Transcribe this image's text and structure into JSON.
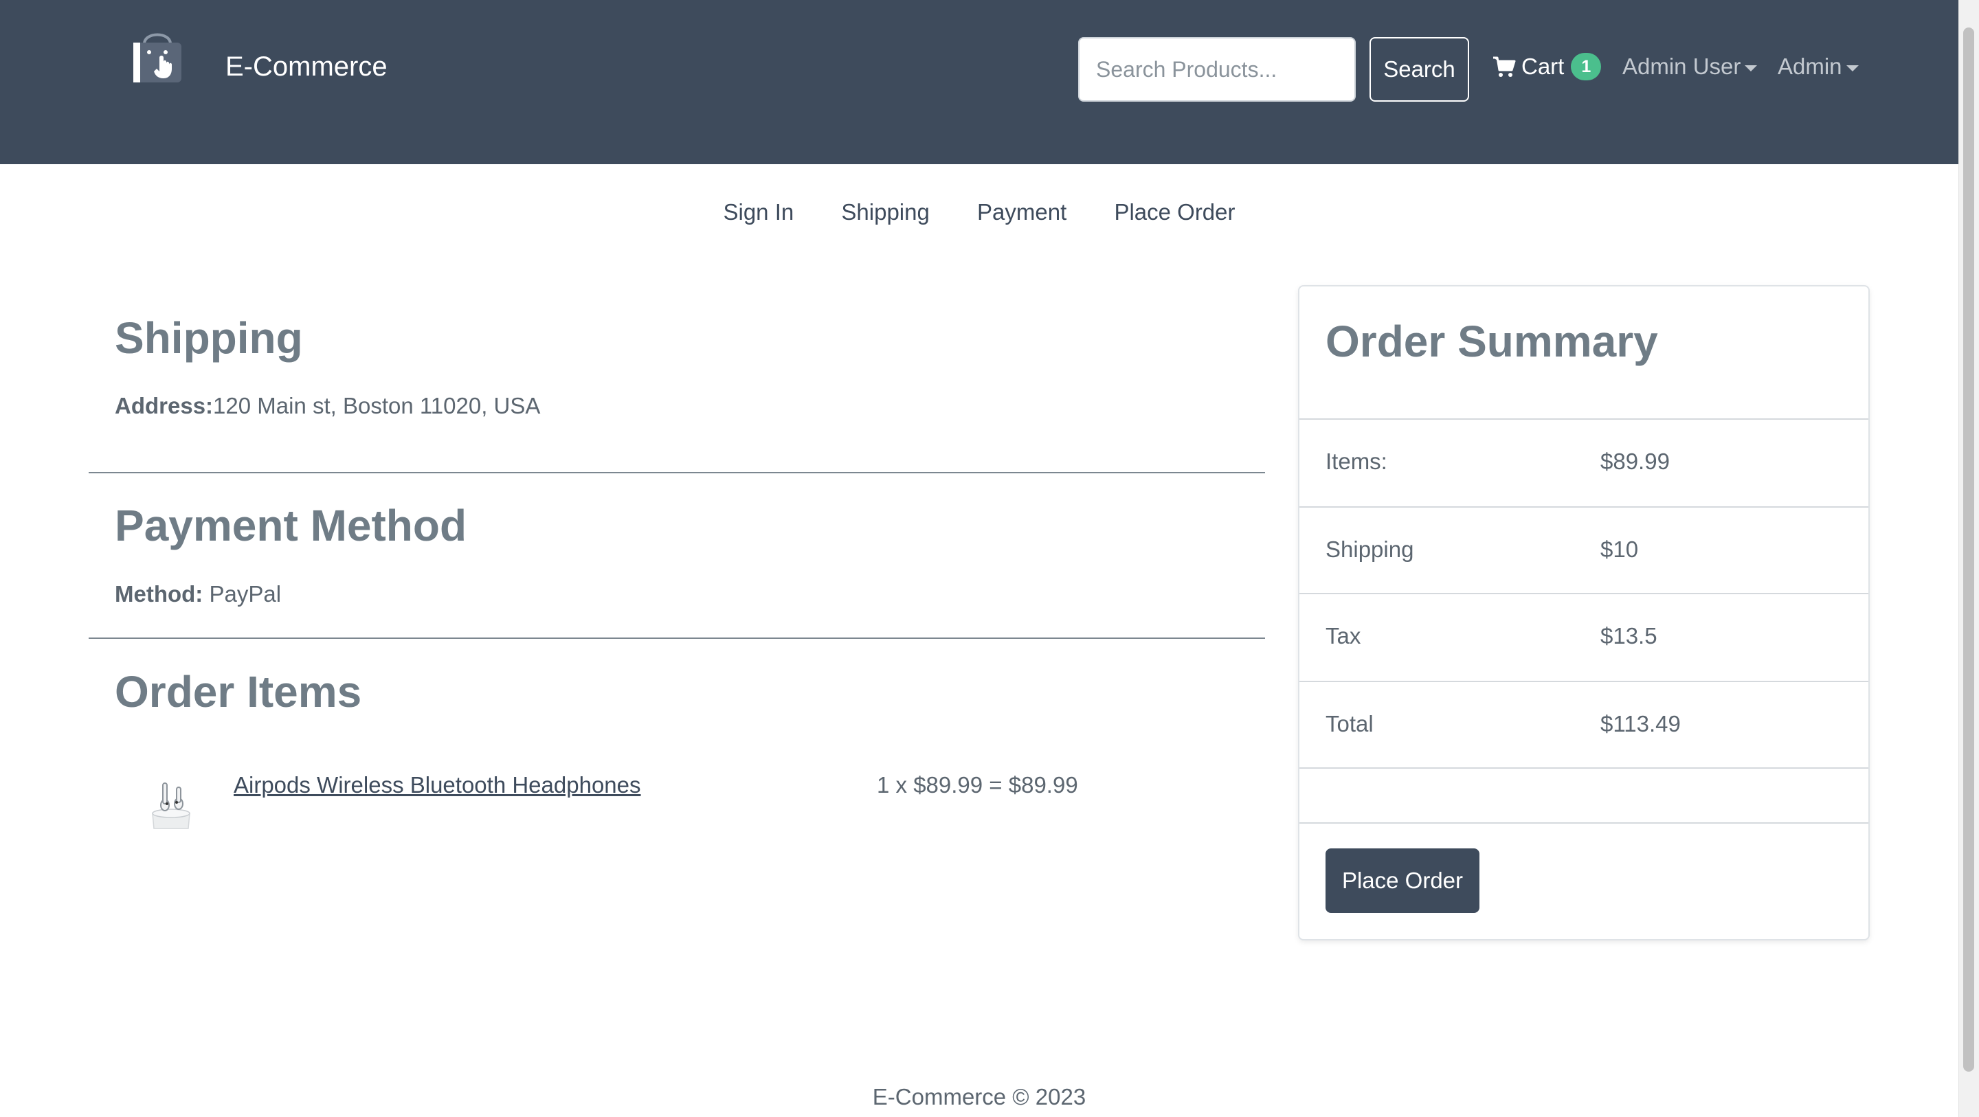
{
  "header": {
    "brand": "E-Commerce",
    "search": {
      "placeholder": "Search Products...",
      "value": "",
      "button_label": "Search"
    },
    "cart": {
      "label": "Cart",
      "count": "1"
    },
    "user_menu_label": "Admin User",
    "admin_menu_label": "Admin"
  },
  "steps": [
    "Sign In",
    "Shipping",
    "Payment",
    "Place Order"
  ],
  "shipping": {
    "title": "Shipping",
    "address_label": "Address:",
    "address_value": "120 Main st, Boston 11020, USA"
  },
  "payment": {
    "title": "Payment Method",
    "method_label": "Method:",
    "method_value": " PayPal"
  },
  "order_items": {
    "title": "Order Items",
    "items": [
      {
        "name": "Airpods Wireless Bluetooth Headphones",
        "price_line": "1 x $89.99 = $89.99"
      }
    ]
  },
  "summary": {
    "title": "Order Summary",
    "rows": [
      {
        "label": "Items:",
        "value": "$89.99"
      },
      {
        "label": "Shipping",
        "value": "$10"
      },
      {
        "label": "Tax",
        "value": "$13.5"
      },
      {
        "label": "Total",
        "value": "$113.49"
      }
    ],
    "button_label": "Place Order"
  },
  "footer": {
    "text": "E-Commerce © 2023"
  },
  "colors": {
    "navbar": "#3e4b5c",
    "badge": "#4bbf8d",
    "heading": "#6f7c86",
    "text": "#5c6670"
  },
  "icons": [
    "shopping-bag-logo-icon",
    "cart-icon",
    "caret-down-icon",
    "airpods-product-image"
  ]
}
